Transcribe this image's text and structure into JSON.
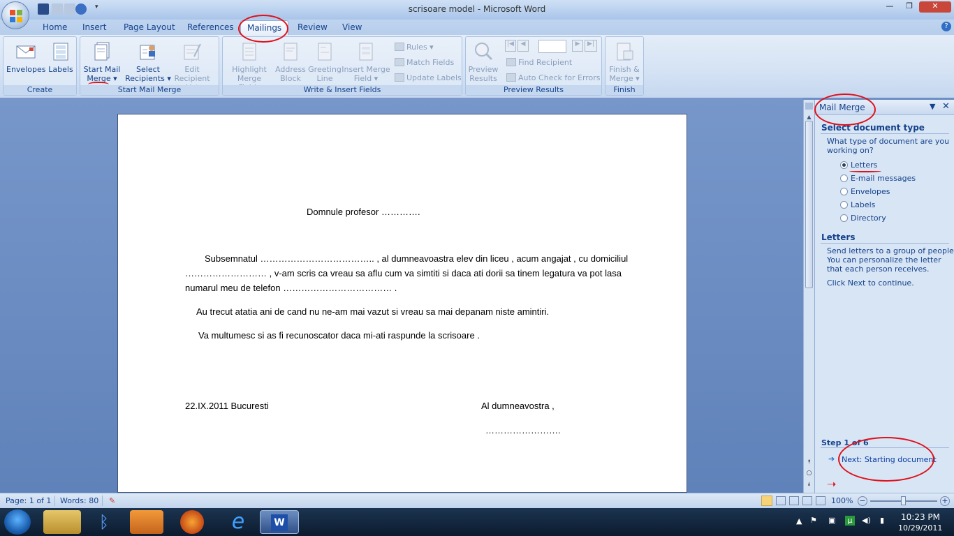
{
  "window": {
    "title": "scrisoare model - Microsoft Word",
    "controls": {
      "minimize": "—",
      "maximize": "❐",
      "close": "✕"
    }
  },
  "tabs": [
    "Home",
    "Insert",
    "Page Layout",
    "References",
    "Mailings",
    "Review",
    "View"
  ],
  "active_tab": "Mailings",
  "ribbon": {
    "groups": {
      "create": {
        "label": "Create",
        "buttons": [
          "Envelopes",
          "Labels"
        ]
      },
      "start": {
        "label": "Start Mail Merge",
        "buttons": [
          {
            "l1": "Start Mail",
            "l2": "Merge ▾"
          },
          {
            "l1": "Select",
            "l2": "Recipients ▾"
          },
          {
            "l1": "Edit",
            "l2": "Recipient List"
          }
        ]
      },
      "write": {
        "label": "Write & Insert Fields",
        "buttons": [
          {
            "l1": "Highlight",
            "l2": "Merge Fields"
          },
          {
            "l1": "Address",
            "l2": "Block"
          },
          {
            "l1": "Greeting",
            "l2": "Line"
          },
          {
            "l1": "Insert Merge",
            "l2": "Field ▾"
          }
        ],
        "small": [
          "Rules ▾",
          "Match Fields",
          "Update Labels"
        ]
      },
      "preview": {
        "label": "Preview Results",
        "big": {
          "l1": "Preview",
          "l2": "Results"
        },
        "small": [
          "Find Recipient",
          "Auto Check for Errors"
        ]
      },
      "finish": {
        "label": "Finish",
        "big": {
          "l1": "Finish &",
          "l2": "Merge ▾"
        }
      }
    }
  },
  "document": {
    "line_title": "Domnule profesor ………….",
    "para1_l1": "Subsemnatul ………………………………..  , al dumneavoastra elev din liceu , acum angajat , cu domiciliul",
    "para1_l2": "……………………… ,  v-am scris ca vreau sa aflu cum va simtiti si daca ati dorii sa tinem legatura va pot lasa",
    "para1_l3": "numarul meu de telefon ……………………………… .",
    "para2": "Au trecut atatia ani de cand nu ne-am mai vazut si vreau sa mai depanam niste amintiri.",
    "para3": "Va multumesc si as fi recunoscator daca mi-ati raspunde la scrisoare .",
    "date": "22.IX.2011  Bucuresti",
    "sign1": "Al dumneavostra ,",
    "sign2": "……………………."
  },
  "pane": {
    "title": "Mail Merge",
    "section1": "Select document type",
    "question": [
      "What type of document are you",
      "working on?"
    ],
    "options": [
      "Letters",
      "E-mail messages",
      "Envelopes",
      "Labels",
      "Directory"
    ],
    "selected": "Letters",
    "section2": "Letters",
    "desc": [
      "Send letters to a group of people.",
      "You can personalize the letter",
      "that each person receives."
    ],
    "click_next": "Click Next to continue.",
    "step": "Step 1 of 6",
    "next_link": "Next: Starting document"
  },
  "status": {
    "page": "Page: 1 of 1",
    "words": "Words: 80",
    "zoom": "100%"
  },
  "tray": {
    "time": "10:23 PM",
    "date": "10/29/2011"
  },
  "colors": {
    "annotation": "#e0101a",
    "ribbon_text": "#15428b"
  }
}
